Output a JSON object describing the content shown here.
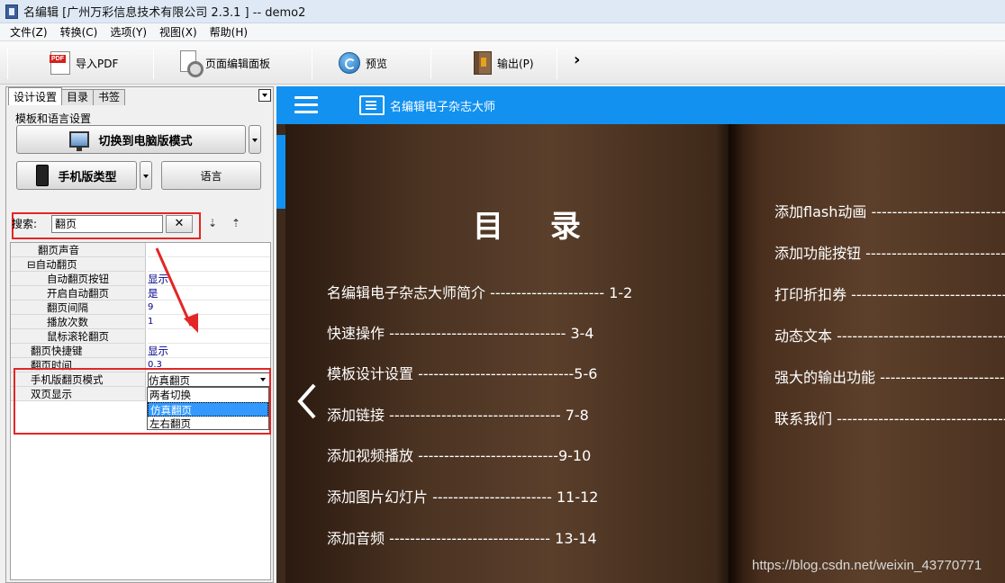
{
  "window": {
    "title": "名编辑 [广州万彩信息技术有限公司 2.3.1 ] -- demo2"
  },
  "menu": [
    "文件(Z)",
    "转换(C)",
    "选项(Y)",
    "视图(X)",
    "帮助(H)"
  ],
  "toolbar": {
    "import_pdf": "导入PDF",
    "page_editor": "页面编辑面板",
    "preview": "预览",
    "output": "输出(P)",
    "more": "›"
  },
  "left_panel": {
    "tabs": [
      "设计设置",
      "目录",
      "书签"
    ],
    "section_title": "模板和语言设置",
    "switch_mode_button": "切换到电脑版模式",
    "mobile_type_button": "手机版类型",
    "language_button": "语言",
    "search": {
      "label": "搜索:",
      "value": "翻页",
      "clear": "✕"
    },
    "properties": [
      {
        "name": "翻页声音",
        "value": "",
        "indent": 2
      },
      {
        "name": "⊟自动翻页",
        "value": "",
        "indent": 1
      },
      {
        "name": "自动翻页按钮",
        "value": "显示",
        "indent": 3
      },
      {
        "name": "开启自动翻页",
        "value": "是",
        "indent": 3
      },
      {
        "name": "翻页间隔",
        "value": "9",
        "indent": 3
      },
      {
        "name": "播放次数",
        "value": "1",
        "indent": 3
      },
      {
        "name": "鼠标滚轮翻页",
        "value": "",
        "indent": 3
      },
      {
        "name": "翻页快捷键",
        "value": "显示",
        "indent": 1
      },
      {
        "name": "翻页时间",
        "value": "0.3",
        "indent": 1
      },
      {
        "name": "手机版翻页模式",
        "value": "仿真翻页",
        "indent": 1
      },
      {
        "name": "双页显示",
        "value": "",
        "indent": 1
      }
    ],
    "dropdown_options": [
      "两者切换",
      "仿真翻页",
      "左右翻页"
    ],
    "dropdown_selected": "仿真翻页"
  },
  "viewer": {
    "brand": "名编辑电子杂志大师",
    "toc_title": "目 录",
    "toc_left": [
      {
        "label": "名编辑电子杂志大师简介 ---------------------- 1-2"
      },
      {
        "label": "快速操作 ---------------------------------- 3-4"
      },
      {
        "label": "模板设计设置 ------------------------------5-6"
      },
      {
        "label": "添加链接 --------------------------------- 7-8"
      },
      {
        "label": "添加视频播放 ---------------------------9-10"
      },
      {
        "label": "添加图片幻灯片 ----------------------- 11-12"
      },
      {
        "label": "添加音频 ------------------------------- 13-14"
      }
    ],
    "toc_right": [
      {
        "label": "添加flash动画 ---------------------------"
      },
      {
        "label": "添加功能按钮 ----------------------------"
      },
      {
        "label": "打印折扣券 -------------------------------"
      },
      {
        "label": "动态文本 ----------------------------------"
      },
      {
        "label": "强大的输出功能 ---------------------------"
      },
      {
        "label": "联系我们 ----------------------------------"
      }
    ],
    "watermark": "https://blog.csdn.net/weixin_43770771"
  },
  "colors": {
    "accent_blue": "#1291f0",
    "highlight_red": "#e32626",
    "selection_blue": "#3399ff"
  }
}
